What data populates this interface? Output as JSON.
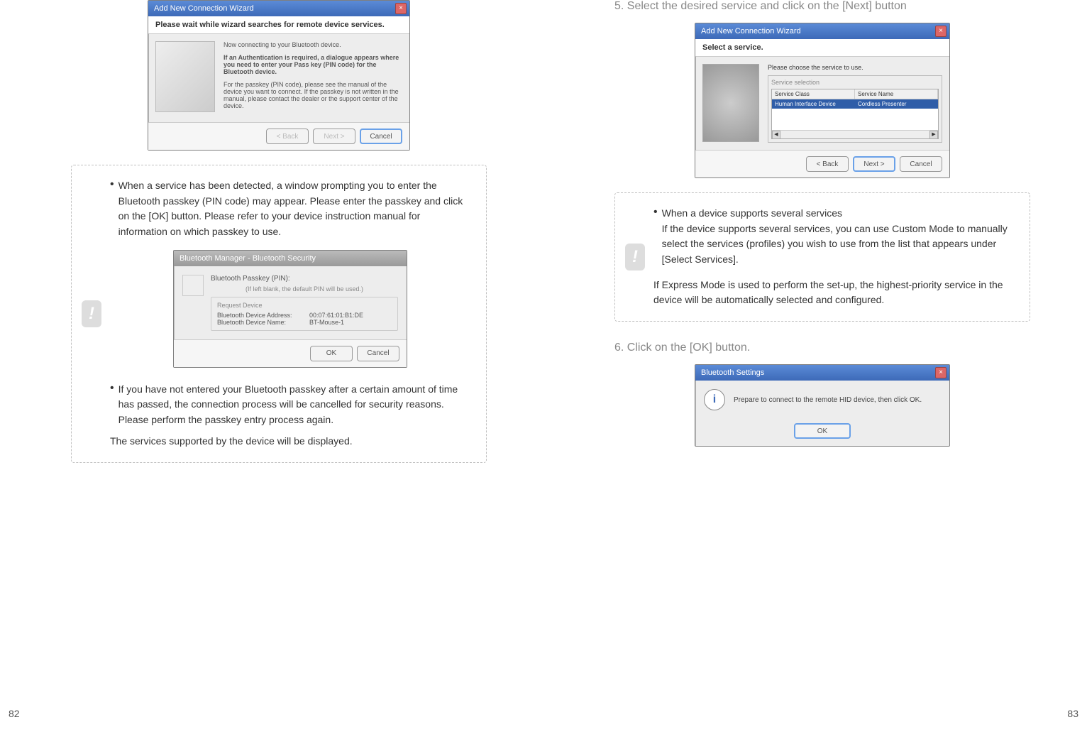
{
  "page_left_num": "82",
  "page_right_num": "83",
  "left": {
    "shot_search": {
      "title": "Add New Connection Wizard",
      "subhead": "Please wait while wizard searches for remote device services.",
      "line1": "Now connecting to your Bluetooth device.",
      "line2": "If an Authentication is required, a dialogue appears where you need to enter your Pass key (PIN code) for the Bluetooth device.",
      "line3": "For the passkey (PIN code), please see the manual of the device you want to connect. If the passkey is not written in the manual, please contact the dealer or the support center of the device.",
      "btn_back": "< Back",
      "btn_next": "Next >",
      "btn_cancel": "Cancel"
    },
    "note1_bullet1": "When a service has been detected, a window prompting you to enter the Bluetooth passkey (PIN code) may appear. Please enter the passkey and click on the [OK] button. Please refer to your device instruction manual for information on which passkey to use.",
    "shot_pass": {
      "title": "Bluetooth Manager - Bluetooth Security",
      "label": "Bluetooth Passkey (PIN):",
      "hint": "(If left blank, the default PIN will be used.)",
      "group_title": "Request Device",
      "addr_label": "Bluetooth Device Address:",
      "addr_value": "00:07:61:01:B1:DE",
      "name_label": "Bluetooth Device Name:",
      "name_value": "BT-Mouse-1",
      "btn_ok": "OK",
      "btn_cancel": "Cancel"
    },
    "note1_bullet2": "If you have not entered your Bluetooth passkey after a certain amount of time has passed, the connection process will be cancelled for security reasons. Please perform the passkey entry process again.",
    "note1_footer": "The services supported by the device will be displayed."
  },
  "right": {
    "step5": "5. Select the desired service and click on the [Next] button",
    "shot_service": {
      "title": "Add New Connection Wizard",
      "subhead": "Select a service.",
      "hint": "Please choose the service to use.",
      "group": "Service selection",
      "col1": "Service Class",
      "col2": "Service Name",
      "cell1": "Human Interface Device",
      "cell2": "Cordless Presenter",
      "btn_back": "< Back",
      "btn_next": "Next >",
      "btn_cancel": "Cancel"
    },
    "note2_bullet_head": "When a device supports several services",
    "note2_bullet_body": "If the device supports several services, you can use Custom Mode to manually select the services (profiles) you wish to use from the list that appears under [Select Services].",
    "note2_footer": "If Express Mode is used to perform the set-up, the highest-priority service in the device will be automatically selected and configured.",
    "step6": "6. Click on the [OK] button.",
    "shot_bts": {
      "title": "Bluetooth Settings",
      "msg": "Prepare to connect to the remote HID device, then click OK.",
      "btn_ok": "OK"
    }
  }
}
